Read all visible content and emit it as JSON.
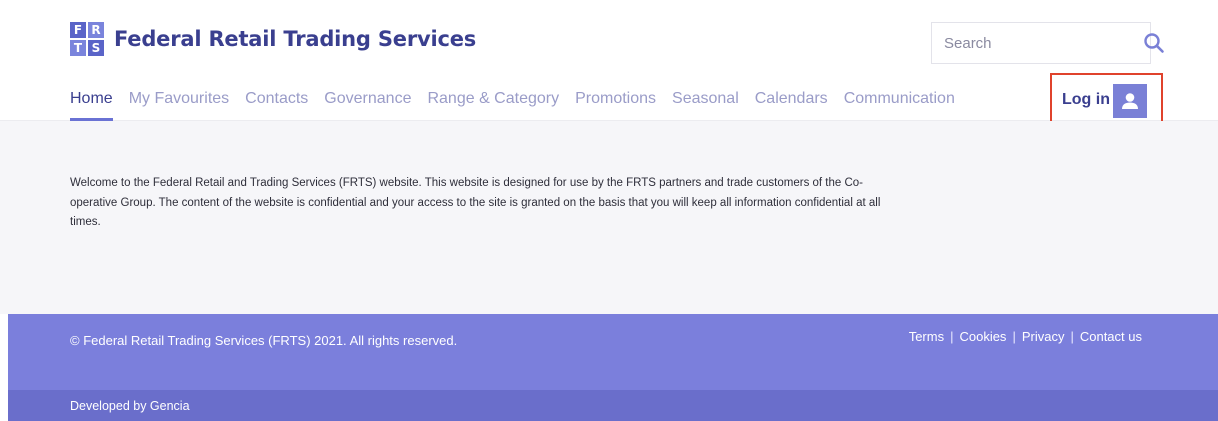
{
  "brand": {
    "logo_letters": [
      "F",
      "R",
      "T",
      "S"
    ],
    "name": "Federal Retail Trading Services",
    "primary_color": "#3a3f8f",
    "accent_color": "#7b7fdc"
  },
  "search": {
    "placeholder": "Search",
    "icon": "search-icon"
  },
  "nav": {
    "items": [
      {
        "label": "Home",
        "active": true
      },
      {
        "label": "My Favourites",
        "active": false
      },
      {
        "label": "Contacts",
        "active": false
      },
      {
        "label": "Governance",
        "active": false
      },
      {
        "label": "Range & Category",
        "active": false
      },
      {
        "label": "Promotions",
        "active": false
      },
      {
        "label": "Seasonal",
        "active": false
      },
      {
        "label": "Calendars",
        "active": false
      },
      {
        "label": "Communication",
        "active": false
      }
    ]
  },
  "login": {
    "label": "Log in",
    "icon": "user-icon",
    "highlight_color": "#e0432c"
  },
  "main": {
    "welcome_text": "Welcome to the Federal Retail and Trading Services (FRTS) website. This website is designed for use by the FRTS partners and trade customers of the Co-operative Group. The content of the website is confidential and your access to the site is granted on the basis that you will keep all information confidential at all times."
  },
  "footer": {
    "copyright": "© Federal Retail Trading Services (FRTS) 2021. All rights reserved.",
    "links": [
      "Terms",
      "Cookies",
      "Privacy",
      "Contact us"
    ],
    "developed_by": "Developed by Gencia"
  }
}
